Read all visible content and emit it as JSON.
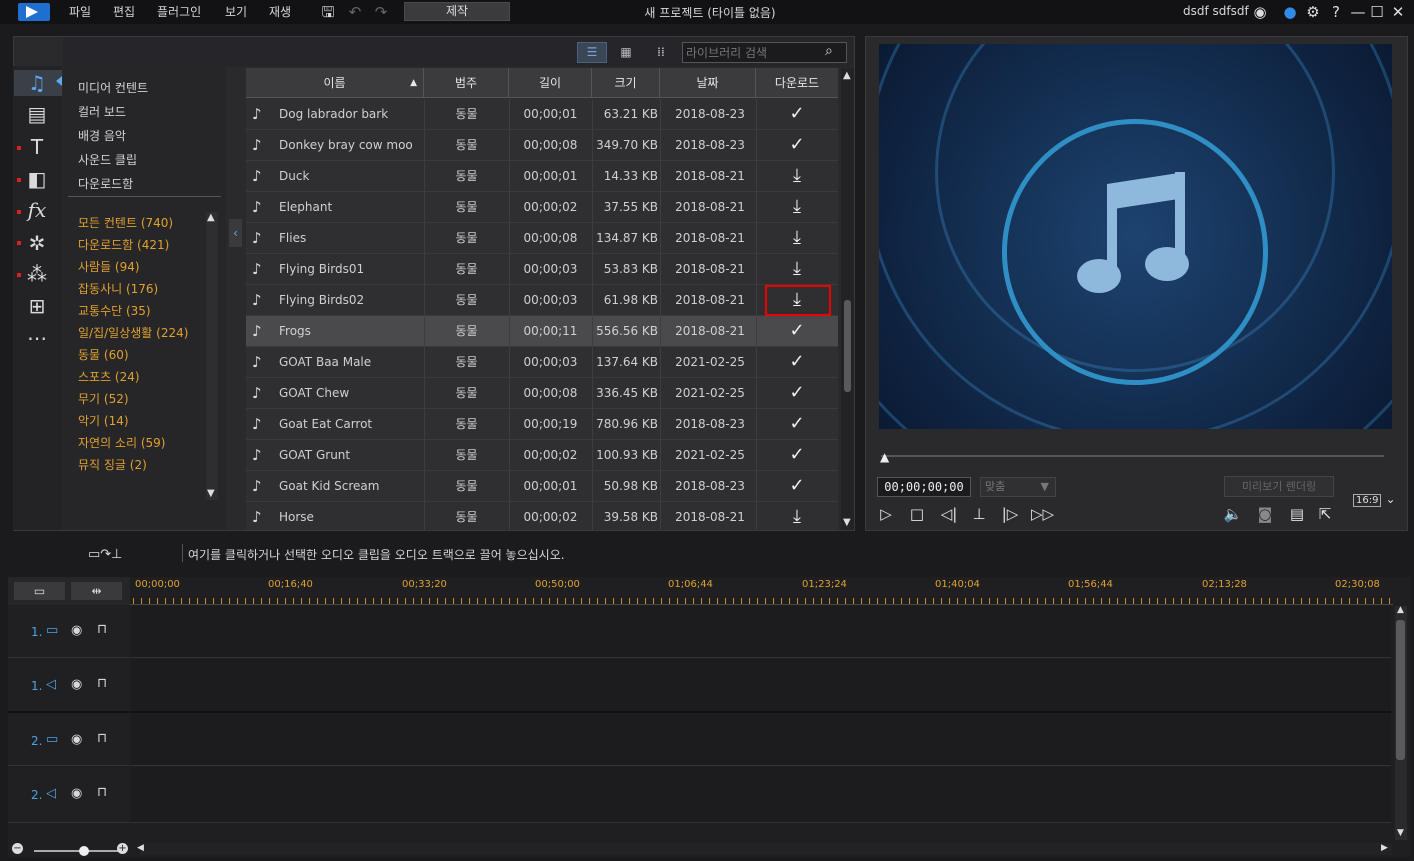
{
  "menu": {
    "file": "파일",
    "edit": "편집",
    "plugin": "플러그인",
    "view": "보기",
    "play": "재생"
  },
  "produce_label": "제작",
  "window_title": "새 프로젝트 (타이틀 없음)",
  "user_name": "dsdf sdfsdf",
  "search_placeholder": "라이브러리 검색",
  "categories": [
    "미디어 컨텐트",
    "컬러 보드",
    "배경 음악",
    "사운드 클립",
    "다운로드함"
  ],
  "subcategories": [
    "모든 컨텐트 (740)",
    "다운로드함 (421)",
    "사람들 (94)",
    "잡동사니 (176)",
    "교통수단 (35)",
    "일/집/일상생활 (224)",
    "동물 (60)",
    "스포츠 (24)",
    "무기 (52)",
    "악기 (14)",
    "자연의 소리 (59)",
    "뮤직 징글 (2)"
  ],
  "table": {
    "headers": {
      "name": "이름",
      "category": "범주",
      "length": "길이",
      "size": "크기",
      "date": "날짜",
      "download": "다운로드"
    },
    "rows": [
      {
        "name": "Dog labrador bark",
        "category": "동물",
        "length": "00;00;01",
        "size": "63.21 KB",
        "date": "2018-08-23",
        "status": "downloaded"
      },
      {
        "name": "Donkey bray cow moo",
        "category": "동물",
        "length": "00;00;08",
        "size": "349.70 KB",
        "date": "2018-08-23",
        "status": "downloaded"
      },
      {
        "name": "Duck",
        "category": "동물",
        "length": "00;00;01",
        "size": "14.33 KB",
        "date": "2018-08-21",
        "status": "download"
      },
      {
        "name": "Elephant",
        "category": "동물",
        "length": "00;00;02",
        "size": "37.55 KB",
        "date": "2018-08-21",
        "status": "download"
      },
      {
        "name": "Flies",
        "category": "동물",
        "length": "00;00;08",
        "size": "134.87 KB",
        "date": "2018-08-21",
        "status": "download"
      },
      {
        "name": "Flying Birds01",
        "category": "동물",
        "length": "00;00;03",
        "size": "53.83 KB",
        "date": "2018-08-21",
        "status": "download"
      },
      {
        "name": "Flying Birds02",
        "category": "동물",
        "length": "00;00;03",
        "size": "61.98 KB",
        "date": "2018-08-21",
        "status": "download"
      },
      {
        "name": "Frogs",
        "category": "동물",
        "length": "00;00;11",
        "size": "556.56 KB",
        "date": "2018-08-21",
        "status": "downloaded"
      },
      {
        "name": "GOAT Baa Male",
        "category": "동물",
        "length": "00;00;03",
        "size": "137.64 KB",
        "date": "2021-02-25",
        "status": "downloaded"
      },
      {
        "name": "GOAT Chew",
        "category": "동물",
        "length": "00;00;08",
        "size": "336.45 KB",
        "date": "2021-02-25",
        "status": "downloaded"
      },
      {
        "name": "Goat Eat  Carrot",
        "category": "동물",
        "length": "00;00;19",
        "size": "780.96 KB",
        "date": "2018-08-23",
        "status": "downloaded"
      },
      {
        "name": "GOAT Grunt",
        "category": "동물",
        "length": "00;00;02",
        "size": "100.93 KB",
        "date": "2021-02-25",
        "status": "downloaded"
      },
      {
        "name": "Goat Kid Scream",
        "category": "동물",
        "length": "00;00;01",
        "size": "50.98 KB",
        "date": "2018-08-23",
        "status": "downloaded"
      },
      {
        "name": "Horse",
        "category": "동물",
        "length": "00;00;02",
        "size": "39.58 KB",
        "date": "2018-08-21",
        "status": "download"
      }
    ]
  },
  "preview": {
    "timecode": "00;00;00;00",
    "fit": "맞춤",
    "render_button": "미리보기 렌더링",
    "ratio": "16:9"
  },
  "hint": "여기를 클릭하거나 선택한 오디오 클립을 오디오 트랙으로 끌어 놓으십시오.",
  "ruler": [
    "00;00;00",
    "00;16;40",
    "00;33;20",
    "00;50;00",
    "01;06;44",
    "01;23;24",
    "01;40;04",
    "01;56;44",
    "02;13;28",
    "02;30;08"
  ],
  "tracks": [
    "1.",
    "1.",
    "2.",
    "2."
  ],
  "colors": {
    "accent": "#1f6fd1",
    "category": "#e0a030",
    "highlight_box": "#e00000"
  }
}
